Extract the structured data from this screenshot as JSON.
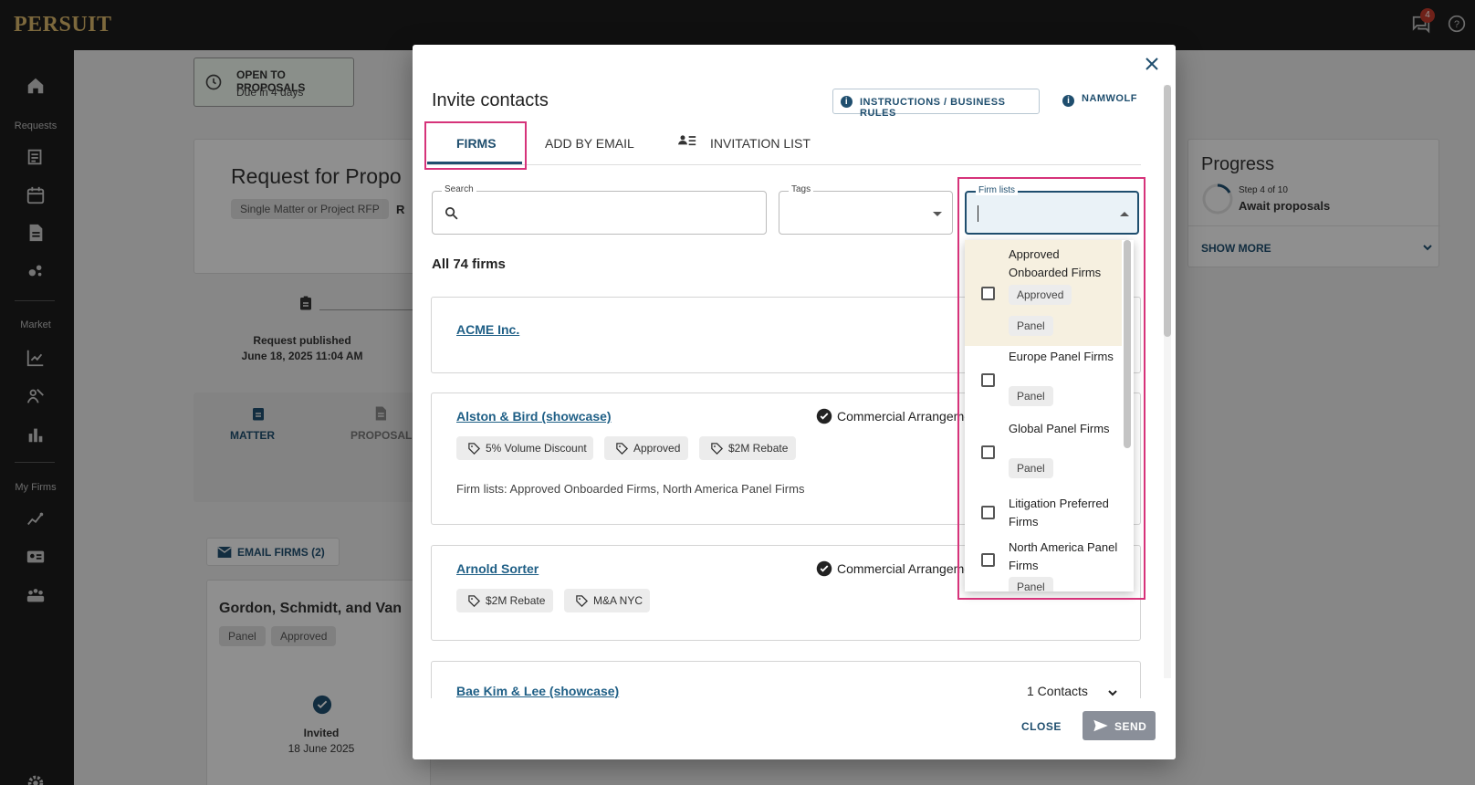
{
  "app": {
    "logo": "PERSUIT",
    "notification_count": "4",
    "icons": [
      "chat-icon",
      "help-icon"
    ]
  },
  "sidebar": {
    "sections": [
      "Requests",
      "Market",
      "My Firms"
    ],
    "icons": [
      "home-icon",
      "add-request-icon",
      "calendar-icon",
      "document-icon",
      "analytics-icon",
      "chart-icon",
      "people-chart-icon",
      "bar-chart-icon",
      "firm-performance-icon",
      "firm-card-icon",
      "firms-group-icon",
      "settings-icon"
    ]
  },
  "background": {
    "status_title": "OPEN TO PROPOSALS",
    "status_sub": "Due in 4 days",
    "request_title": "Request for Propo",
    "request_type_chip": "Single Matter or Project RFP",
    "request_trunc": "R",
    "timeline_label": "Request published",
    "timeline_date": "June 18, 2025 11:04 AM",
    "tab_matter": "MATTER",
    "tab_proposal": "PROPOSAL",
    "email_firms": "EMAIL FIRMS (2)",
    "firm_name": "Gordon, Schmidt, and Van",
    "firm_chips": [
      "Panel",
      "Approved"
    ],
    "invited_label": "Invited",
    "invited_date": "18 June 2025",
    "progress_title": "Progress",
    "progress_step": "Step 4 of 10",
    "progress_stage": "Await proposals",
    "show_more": "SHOW MORE"
  },
  "modal": {
    "title": "Invite contacts",
    "instructions_button": "INSTRUCTIONS / BUSINESS RULES",
    "namwolf": "NAMWOLF",
    "tabs": [
      "FIRMS",
      "ADD BY EMAIL",
      "INVITATION LIST"
    ],
    "search_label": "Search",
    "search_value": "",
    "tags_label": "Tags",
    "firm_lists_label": "Firm lists",
    "firm_lists_value": "",
    "all_firms": "All 74 firms",
    "firms": [
      {
        "name": "ACME Inc."
      },
      {
        "name": "Alston & Bird (showcase)",
        "commercial": "Commercial Arrangeme",
        "tags": [
          "5% Volume Discount",
          "Approved",
          "$2M Rebate"
        ],
        "firm_lists": "Firm lists: Approved Onboarded Firms, North America Panel Firms"
      },
      {
        "name": "Arnold Sorter",
        "commercial": "Commercial Arrangeme",
        "tags": [
          "$2M Rebate",
          "M&A NYC"
        ]
      },
      {
        "name": "Bae Kim & Lee (showcase)",
        "contacts": "1 Contacts"
      }
    ],
    "close": "CLOSE",
    "send": "SEND"
  },
  "dropdown": {
    "items": [
      {
        "label": "Approved Onboarded Firms",
        "chips": [
          "Approved",
          "Panel"
        ]
      },
      {
        "label": "Europe Panel Firms",
        "chips": [
          "Panel"
        ]
      },
      {
        "label": "Global Panel Firms",
        "chips": [
          "Panel"
        ]
      },
      {
        "label": "Litigation Preferred Firms",
        "chips": []
      },
      {
        "label": "North America Panel Firms",
        "chips": [
          "Panel"
        ]
      }
    ]
  },
  "colors": {
    "accent": "#1f4e6e",
    "highlight": "#d6337a",
    "logo": "#d8b56a",
    "hover_row": "#f6f0e0"
  }
}
